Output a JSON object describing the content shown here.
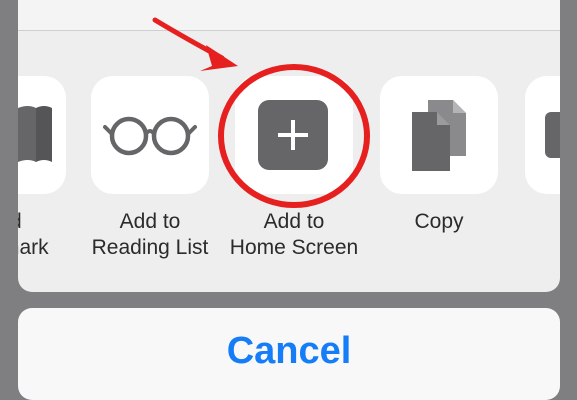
{
  "share_sheet": {
    "actions": [
      {
        "name": "bookmark",
        "label_lines": [
          "d",
          "mark"
        ]
      },
      {
        "name": "reading-list",
        "label_lines": [
          "Add to",
          "Reading List"
        ]
      },
      {
        "name": "home-screen",
        "label_lines": [
          "Add to",
          "Home Screen"
        ]
      },
      {
        "name": "copy",
        "label_lines": [
          "Copy"
        ]
      }
    ]
  },
  "cancel": {
    "label": "Cancel"
  },
  "colors": {
    "annotation": "#e61f1f",
    "accent": "#147df7",
    "icon": "#666669",
    "sheet_background": "#eeeeef",
    "dimmed_background": "#7f7f81"
  }
}
